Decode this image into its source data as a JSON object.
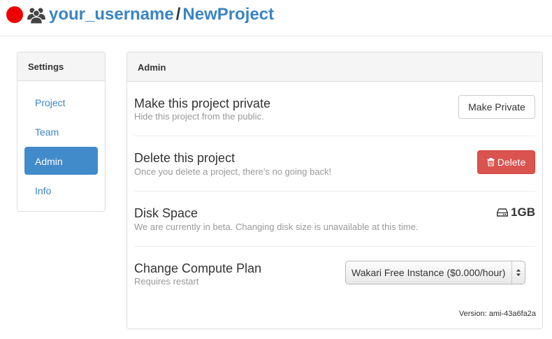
{
  "header": {
    "username": "your_username",
    "separator": "/",
    "project": "NewProject"
  },
  "icons": {
    "status": "red-circle",
    "group": "users-icon",
    "trash": "trash-icon",
    "drive": "hdd-icon",
    "select_arrows": "updown-chevron-icon"
  },
  "colors": {
    "link": "#3a84c4",
    "active_nav": "#428bca",
    "danger": "#d9534f",
    "status_dot": "#ee0000"
  },
  "sidebar": {
    "title": "Settings",
    "items": [
      {
        "label": "Project",
        "active": false
      },
      {
        "label": "Team",
        "active": false
      },
      {
        "label": "Admin",
        "active": true
      },
      {
        "label": "Info",
        "active": false
      }
    ]
  },
  "admin": {
    "title": "Admin",
    "private": {
      "title": "Make this project private",
      "subtitle": "Hide this project from the public.",
      "button": "Make Private"
    },
    "delete": {
      "title": "Delete this project",
      "subtitle": "Once you delete a project, there's no going back!",
      "button": "Delete"
    },
    "disk": {
      "title": "Disk Space",
      "subtitle": "We are currently in beta. Changing disk size is unavailable at this time.",
      "value": "1GB"
    },
    "compute": {
      "title": "Change Compute Plan",
      "subtitle": "Requires restart",
      "selected": "Wakari Free Instance ($0.000/hour)"
    },
    "version": "Version: ami-43a6fa2a"
  }
}
